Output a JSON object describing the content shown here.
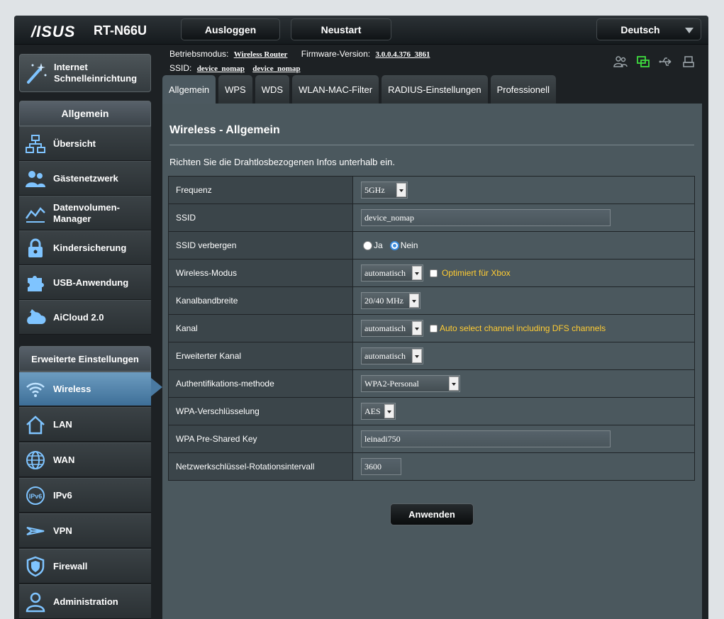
{
  "header": {
    "brand": "/ISUS",
    "model": "RT-N66U",
    "logout_label": "Ausloggen",
    "restart_label": "Neustart",
    "language": "Deutsch"
  },
  "info": {
    "mode_label": "Betriebsmodus:",
    "mode_value": "Wireless Router",
    "firmware_label": "Firmware-Version:",
    "firmware_value": "3.0.0.4.376_3861",
    "ssid_label": "SSID:",
    "ssid_1": "device_nomap",
    "ssid_2": "device_nomap"
  },
  "sidebar": {
    "qis_label_line1": "Internet",
    "qis_label_line2": "Schnelleinrichtung",
    "general_heading": "Allgemein",
    "general_items": [
      {
        "label": "Übersicht"
      },
      {
        "label": "Gästenetzwerk"
      },
      {
        "label": "Datenvolumen-Manager"
      },
      {
        "label": "Kindersicherung"
      },
      {
        "label": "USB-Anwendung"
      },
      {
        "label": "AiCloud 2.0"
      }
    ],
    "advanced_heading": "Erweiterte Einstellungen",
    "advanced_items": [
      {
        "label": "Wireless"
      },
      {
        "label": "LAN"
      },
      {
        "label": "WAN"
      },
      {
        "label": "IPv6"
      },
      {
        "label": "VPN"
      },
      {
        "label": "Firewall"
      },
      {
        "label": "Administration"
      }
    ]
  },
  "tabs": [
    "Allgemein",
    "WPS",
    "WDS",
    "WLAN-MAC-Filter",
    "RADIUS-Einstellungen",
    "Professionell"
  ],
  "main": {
    "title": "Wireless - Allgemein",
    "description": "Richten Sie die Drahtlosbezogenen Infos unterhalb ein.",
    "apply_label": "Anwenden",
    "rows": {
      "frequency": {
        "label": "Frequenz",
        "value": "5GHz"
      },
      "ssid": {
        "label": "SSID",
        "value": "device_nomap"
      },
      "hide_ssid": {
        "label": "SSID verbergen",
        "option_yes": "Ja",
        "option_no": "Nein",
        "selected": "Nein"
      },
      "wireless_mode": {
        "label": "Wireless-Modus",
        "value": "automatisch",
        "checkbox_label": "Optimiert für Xbox"
      },
      "bandwidth": {
        "label": "Kanalbandbreite",
        "value": "20/40 MHz"
      },
      "channel": {
        "label": "Kanal",
        "value": "automatisch",
        "checkbox_label": "Auto select channel including DFS channels"
      },
      "ext_channel": {
        "label": "Erweiterter Kanal",
        "value": "automatisch"
      },
      "auth": {
        "label": "Authentifikations-methode",
        "value": "WPA2-Personal"
      },
      "encryption": {
        "label": "WPA-Verschlüsselung",
        "value": "AES"
      },
      "psk": {
        "label": "WPA Pre-Shared Key",
        "value": "leinadi750"
      },
      "rotation": {
        "label": "Netzwerkschlüssel-Rotationsintervall",
        "value": "3600"
      }
    }
  }
}
